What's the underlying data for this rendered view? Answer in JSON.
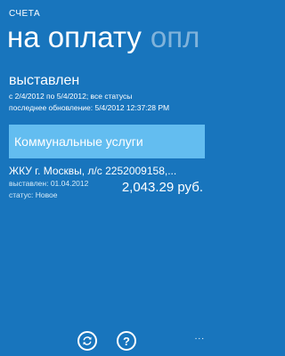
{
  "app": {
    "title": "СЧЕТА"
  },
  "pivot": {
    "active_tab": "на оплату",
    "next_tab": "опл"
  },
  "filter": {
    "status": "выставлен",
    "period": "с 2/4/2012 по 5/4/2012; все статусы",
    "last_update": "последнее обновление: 5/4/2012 12:37:28 PM"
  },
  "category": {
    "label": "Коммунальные услуги",
    "color": "#63bdf0"
  },
  "bills": [
    {
      "name": "ЖКУ г. Москвы, л/с 2252009158,...",
      "issued": "выставлен: 01.04.2012",
      "status": "статус: Новое",
      "amount": "2,043.29 руб."
    }
  ],
  "appbar": {
    "buttons": [
      {
        "icon": "refresh-icon"
      },
      {
        "icon": "help-icon",
        "glyph": "?"
      }
    ],
    "more": "..."
  },
  "colors": {
    "background": "#1875bd",
    "accent": "#63bdf0",
    "text": "#ffffff"
  }
}
